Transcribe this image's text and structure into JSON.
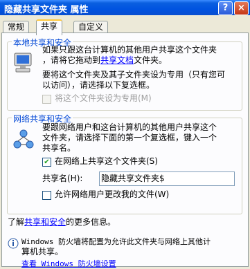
{
  "window": {
    "title": "隐藏共享文件夹 属性",
    "help_btn": "?",
    "close_btn": "×"
  },
  "tabs": [
    {
      "label": "常规"
    },
    {
      "label": "共享"
    },
    {
      "label": "自定义"
    }
  ],
  "local_group": {
    "title": "本地共享和安全",
    "line1": "如果只跟这台计算机的其他用户共享这个文件夹",
    "line2_pre": "，请将它拖动到",
    "line2_link": "共享文档",
    "line2_post": "文件夹。",
    "line3": "要将这个文件夹及其子文件夹设为专用（只有您可",
    "line4": "以访问），请选择以下复选框。",
    "private_checkbox_label": "将这个文件夹设为专用(M)"
  },
  "network_group": {
    "title": "网络共享和安全",
    "line1": "要跟网络用户和这台计算机的其他用户共享这个",
    "line2": "文件夹，请选择下面的第一个复选框，键入一个",
    "line3": "共享名。",
    "share_checkbox_label": "在网络上共享这个文件夹(S)",
    "share_checked": true,
    "share_name_label": "共享名(H):",
    "share_name_value": "隐藏共享文件夹$",
    "allow_change_label": "允许网络用户更改我的文件(W)",
    "allow_change_checked": false
  },
  "more_info": {
    "pre": "了解",
    "link": "共享和安全",
    "post": "的更多信息。"
  },
  "firewall": {
    "line1": "Windows 防火墙将配置为允许此文件夹与网络上其他计",
    "line2": "算机共享。",
    "link": "查看 Windows 防火墙设置"
  }
}
